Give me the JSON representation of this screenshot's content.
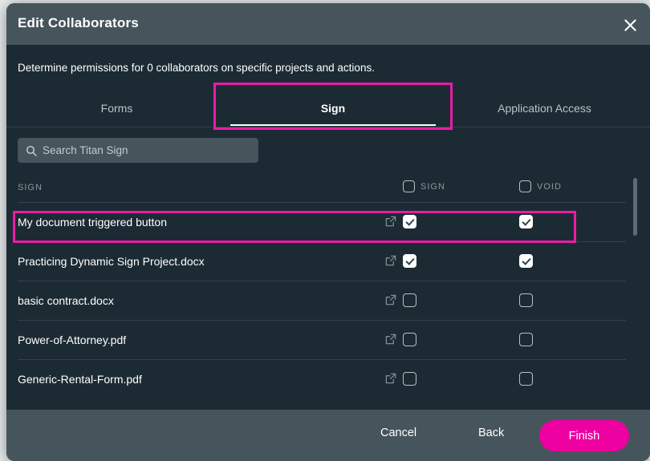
{
  "dialog": {
    "title": "Edit  Collaborators",
    "subtitle": "Determine permissions for 0 collaborators on specific projects and actions.",
    "close_icon": "close-icon",
    "accent_color": "#ec00a0",
    "highlight_color": "#ec1ba6",
    "header_bg": "#46555c",
    "body_bg": "#1c2b33"
  },
  "tabs": [
    {
      "label": "Forms",
      "active": false
    },
    {
      "label": "Sign",
      "active": true
    },
    {
      "label": "Application Access",
      "active": false
    }
  ],
  "search": {
    "placeholder": "Search Titan Sign",
    "value": "",
    "icon": "search-icon"
  },
  "table": {
    "name_header": "SIGN",
    "columns": [
      {
        "label": "SIGN",
        "checked": false
      },
      {
        "label": "VOID",
        "checked": false
      }
    ],
    "rows": [
      {
        "name": "My document triggered button",
        "sign": true,
        "void": true,
        "highlighted": true
      },
      {
        "name": "Practicing Dynamic Sign Project.docx",
        "sign": true,
        "void": true,
        "highlighted": false
      },
      {
        "name": "basic contract.docx",
        "sign": false,
        "void": false,
        "highlighted": false
      },
      {
        "name": "Power-of-Attorney.pdf",
        "sign": false,
        "void": false,
        "highlighted": false
      },
      {
        "name": "Generic-Rental-Form.pdf",
        "sign": false,
        "void": false,
        "highlighted": false
      }
    ],
    "row_action_icon": "external-link-icon"
  },
  "footer": {
    "cancel_label": "Cancel",
    "back_label": "Back",
    "finish_label": "Finish"
  }
}
